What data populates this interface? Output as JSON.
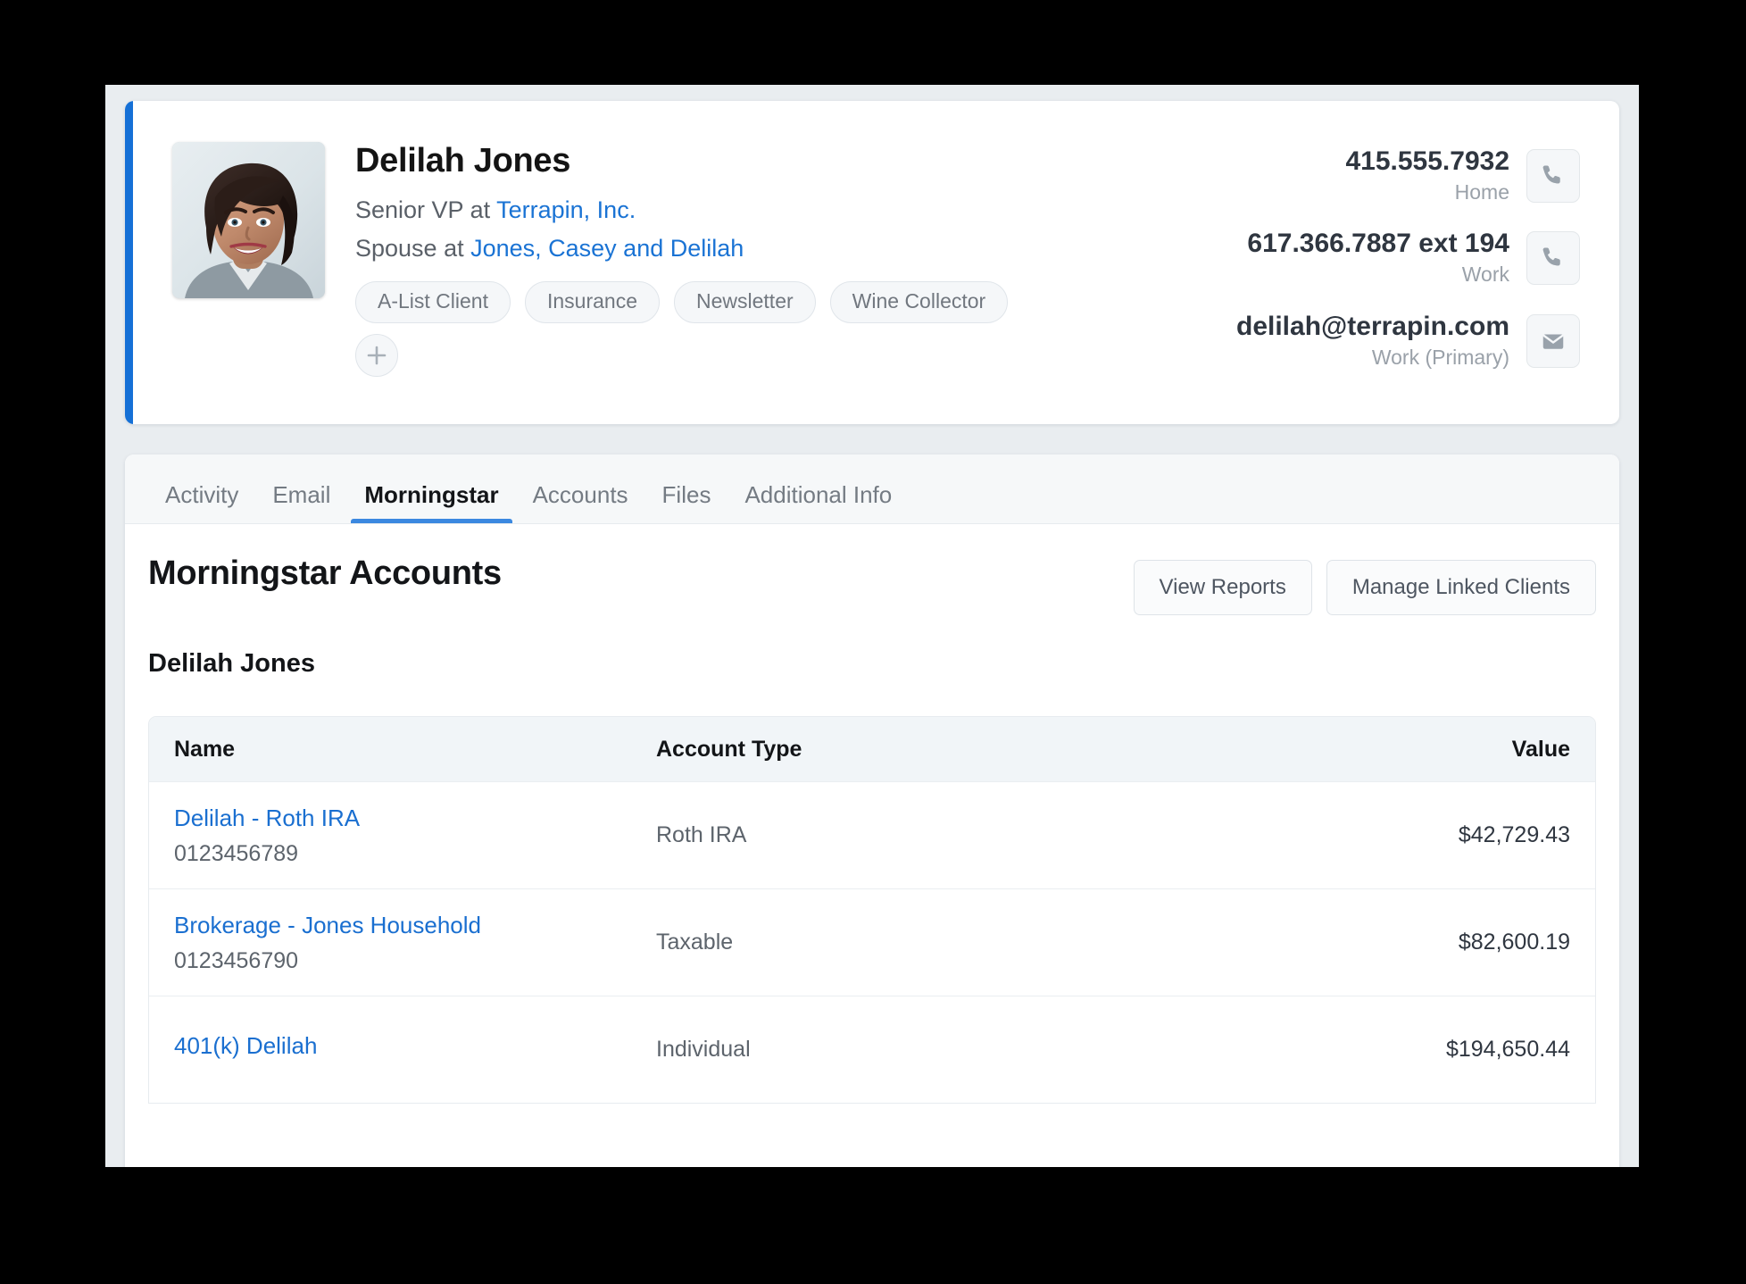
{
  "colors": {
    "accent_bar": "#1570d6",
    "link": "#1a73d4",
    "tab_underline": "#3b88e0",
    "page_bg": "#e9edf0",
    "table_header_bg": "#f1f5f8"
  },
  "header": {
    "avatar_alt": "avatar-photo",
    "name": "Delilah Jones",
    "relationships": [
      {
        "prefix": "Senior VP at ",
        "link": "Terrapin, Inc."
      },
      {
        "prefix": "Spouse at ",
        "link": "Jones, Casey and Delilah"
      }
    ],
    "tags": [
      "A-List Client",
      "Insurance",
      "Newsletter",
      "Wine Collector"
    ],
    "add_tag_icon": "plus-icon",
    "contacts": [
      {
        "value": "415.555.7932",
        "label": "Home",
        "icon": "phone-icon"
      },
      {
        "value": "617.366.7887 ext 194",
        "label": "Work",
        "icon": "phone-icon"
      },
      {
        "value": "delilah@terrapin.com",
        "label": "Work (Primary)",
        "icon": "email-icon"
      }
    ]
  },
  "tabs": [
    {
      "label": "Activity",
      "active": false
    },
    {
      "label": "Email",
      "active": false
    },
    {
      "label": "Morningstar",
      "active": true
    },
    {
      "label": "Accounts",
      "active": false
    },
    {
      "label": "Files",
      "active": false
    },
    {
      "label": "Additional Info",
      "active": false
    }
  ],
  "panel": {
    "title": "Morningstar Accounts",
    "subtitle": "Delilah Jones",
    "actions": [
      {
        "label": "View Reports"
      },
      {
        "label": "Manage Linked Clients"
      }
    ]
  },
  "table": {
    "columns": [
      "Name",
      "Account Type",
      "Value"
    ],
    "rows": [
      {
        "name": "Delilah - Roth IRA",
        "number": "0123456789",
        "type": "Roth IRA",
        "value": "$42,729.43"
      },
      {
        "name": "Brokerage - Jones Household",
        "number": "0123456790",
        "type": "Taxable",
        "value": "$82,600.19"
      },
      {
        "name": "401(k) Delilah",
        "number": "",
        "type": "Individual",
        "value": "$194,650.44"
      }
    ]
  }
}
